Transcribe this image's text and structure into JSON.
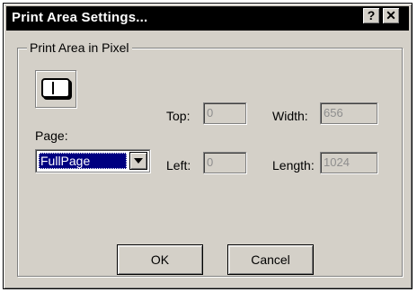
{
  "dialog": {
    "title": "Print Area Settings...",
    "help_label": "?",
    "close_label": "✕"
  },
  "group": {
    "label": "Print  Area in Pixel",
    "orientation_icon": "portrait-page-icon"
  },
  "page": {
    "label": "Page:",
    "selected": "FullPage"
  },
  "fields": {
    "top_label": "Top:",
    "top_value": "0",
    "left_label": "Left:",
    "left_value": "0",
    "width_label": "Width:",
    "width_value": "656",
    "length_label": "Length:",
    "length_value": "1024"
  },
  "buttons": {
    "ok": "OK",
    "cancel": "Cancel"
  }
}
